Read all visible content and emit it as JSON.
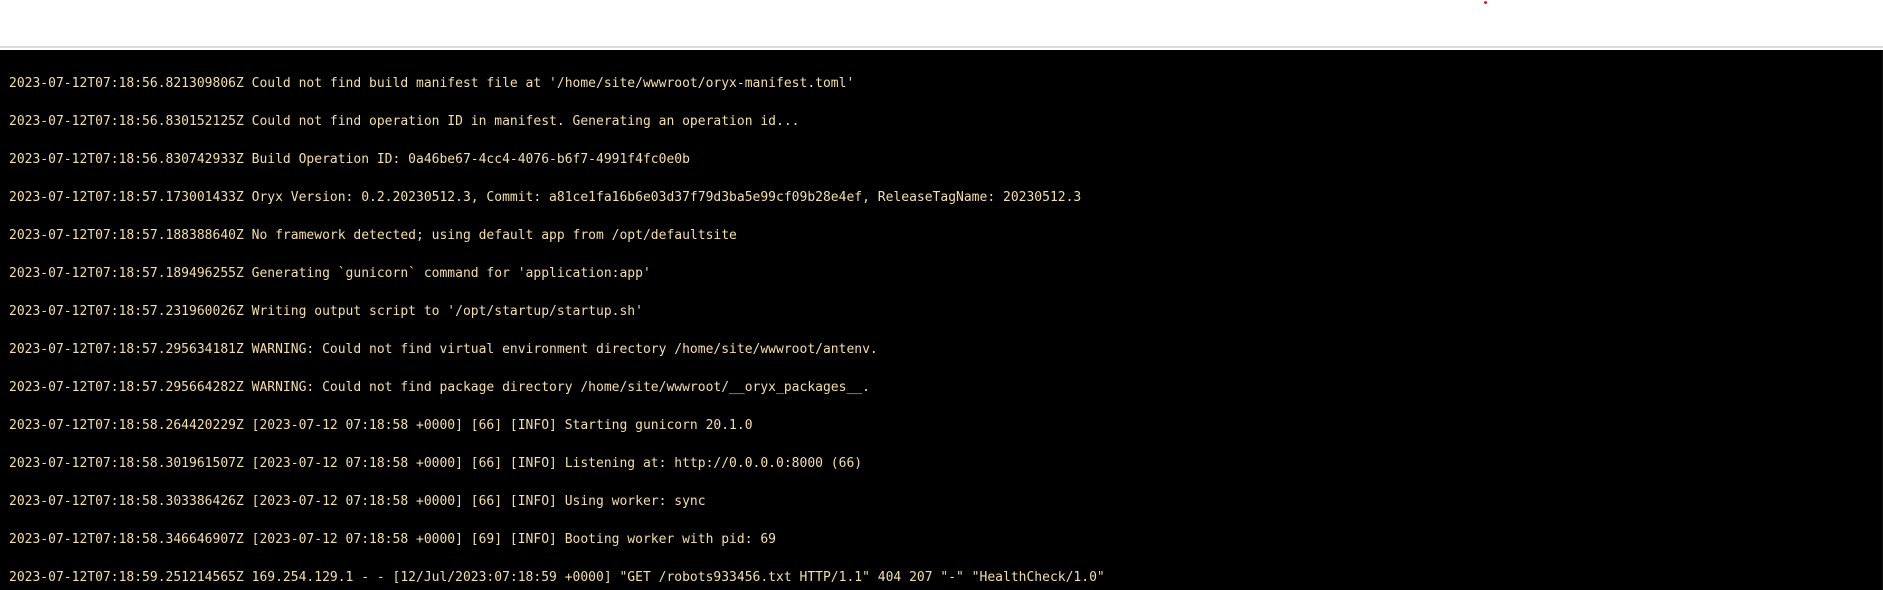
{
  "log": {
    "lines": [
      "2023-07-12T07:18:56.821309806Z Could not find build manifest file at '/home/site/wwwroot/oryx-manifest.toml'",
      "2023-07-12T07:18:56.830152125Z Could not find operation ID in manifest. Generating an operation id...",
      "2023-07-12T07:18:56.830742933Z Build Operation ID: 0a46be67-4cc4-4076-b6f7-4991f4fc0e0b",
      "2023-07-12T07:18:57.173001433Z Oryx Version: 0.2.20230512.3, Commit: a81ce1fa16b6e03d37f79d3ba5e99cf09b28e4ef, ReleaseTagName: 20230512.3",
      "2023-07-12T07:18:57.188388640Z No framework detected; using default app from /opt/defaultsite",
      "2023-07-12T07:18:57.189496255Z Generating `gunicorn` command for 'application:app'",
      "2023-07-12T07:18:57.231960026Z Writing output script to '/opt/startup/startup.sh'",
      "2023-07-12T07:18:57.295634181Z WARNING: Could not find virtual environment directory /home/site/wwwroot/antenv.",
      "2023-07-12T07:18:57.295664282Z WARNING: Could not find package directory /home/site/wwwroot/__oryx_packages__.",
      "2023-07-12T07:18:58.264420229Z [2023-07-12 07:18:58 +0000] [66] [INFO] Starting gunicorn 20.1.0",
      "2023-07-12T07:18:58.301961507Z [2023-07-12 07:18:58 +0000] [66] [INFO] Listening at: http://0.0.0.0:8000 (66)",
      "2023-07-12T07:18:58.303386426Z [2023-07-12 07:18:58 +0000] [66] [INFO] Using worker: sync",
      "2023-07-12T07:18:58.346646907Z [2023-07-12 07:18:58 +0000] [69] [INFO] Booting worker with pid: 69",
      "2023-07-12T07:18:59.251214565Z 169.254.129.1 - - [12/Jul/2023:07:18:59 +0000] \"GET /robots933456.txt HTTP/1.1\" 404 207 \"-\" \"HealthCheck/1.0\""
    ]
  },
  "colors": {
    "log_background": "#000000",
    "log_text": "#f5deaa",
    "top_bar": "#ffffff",
    "indicator_dot": "#e81123"
  }
}
